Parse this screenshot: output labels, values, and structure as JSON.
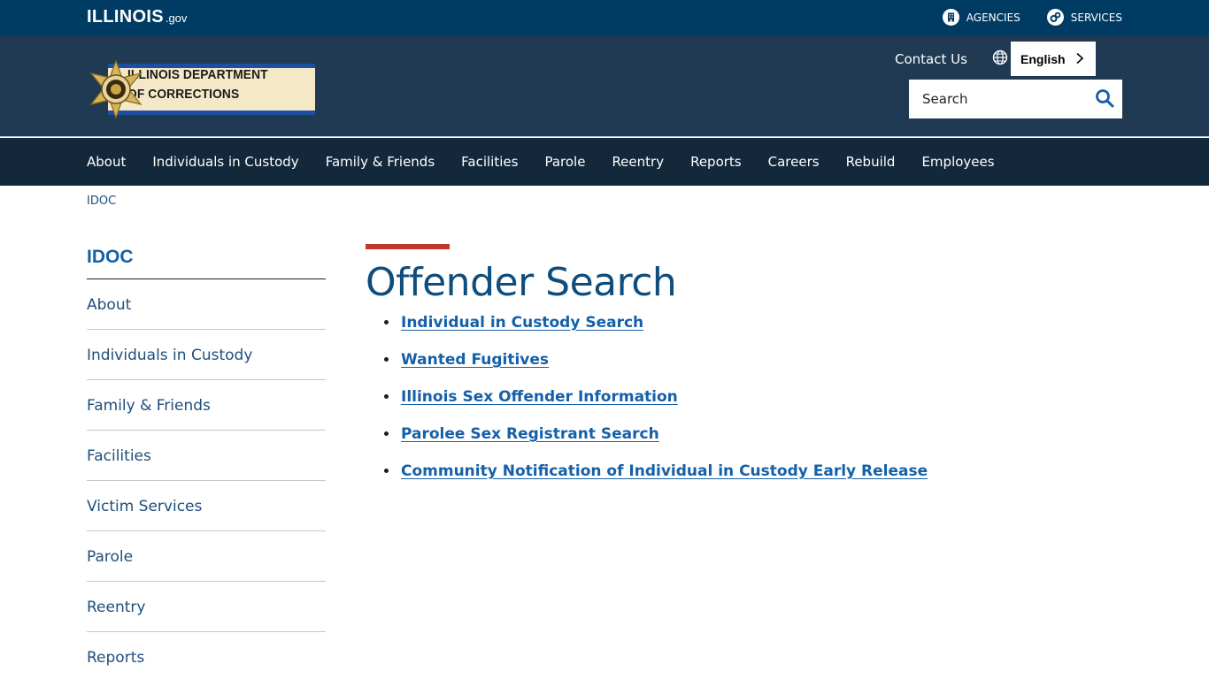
{
  "topbar": {
    "logo_word": "ILLINOIS",
    "logo_gov": ".gov",
    "agencies_label": "AGENCIES",
    "services_label": "SERVICES"
  },
  "header": {
    "brand_line1": "ILLINOIS DEPARTMENT",
    "brand_line2": "OF CORRECTIONS",
    "contact_label": "Contact Us",
    "language_label": "English",
    "search_placeholder": "Search"
  },
  "main_nav": {
    "items": [
      "About",
      "Individuals in Custody",
      "Family & Friends",
      "Facilities",
      "Parole",
      "Reentry",
      "Reports",
      "Careers",
      "Rebuild",
      "Employees"
    ]
  },
  "breadcrumb": {
    "root": "IDOC"
  },
  "sidebar": {
    "title": "IDOC",
    "items": [
      "About",
      "Individuals in Custody",
      "Family & Friends",
      "Facilities",
      "Victim Services",
      "Parole",
      "Reentry",
      "Reports"
    ]
  },
  "content": {
    "title": "Offender Search",
    "links": [
      "Individual in Custody Search",
      "Wanted Fugitives",
      "Illinois Sex Offender Information",
      "Parolee Sex Registrant Search",
      "Community Notification of Individual in Custody Early Release"
    ]
  },
  "colors": {
    "topbar": "#003b64",
    "header": "#1f3a52",
    "main_nav": "#13283b",
    "link": "#1560a8",
    "title": "#0e4d7c",
    "accent": "#c3362b"
  }
}
